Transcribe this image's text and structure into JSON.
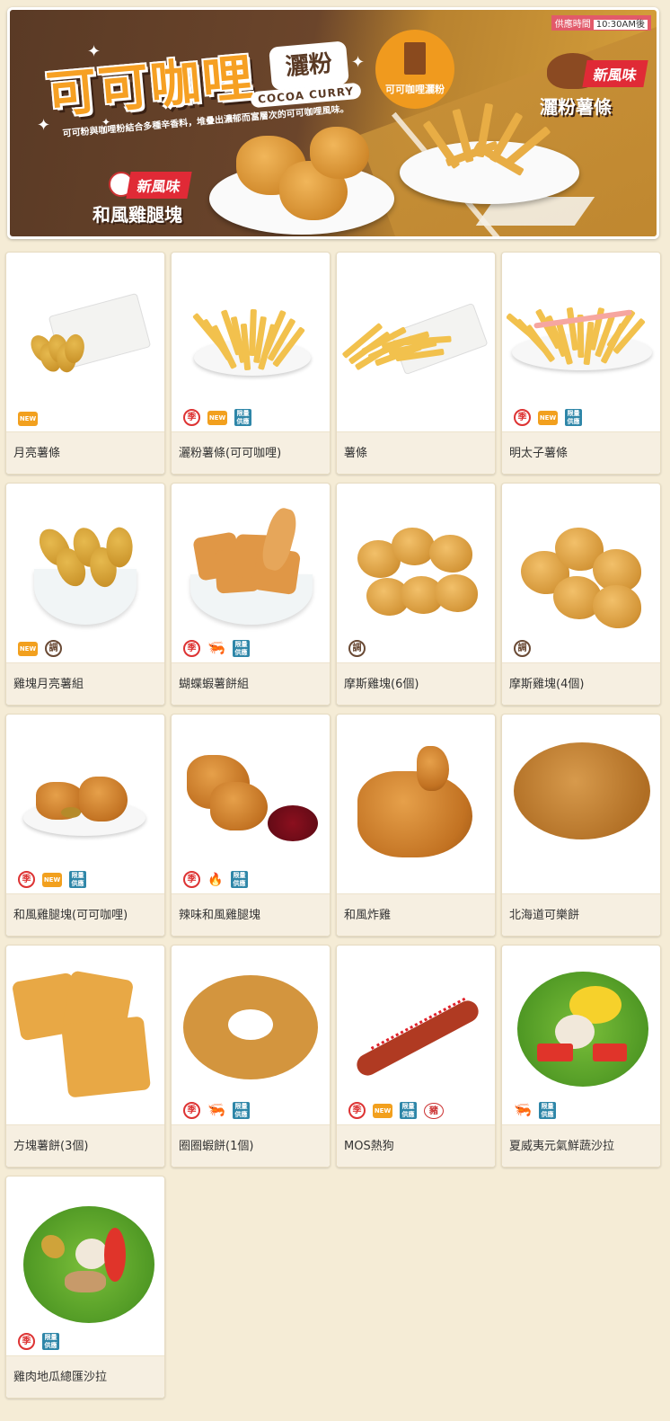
{
  "banner": {
    "title": "可可咖哩",
    "title_sub": "灑粉",
    "subtitle_en": "COCOA CURRY",
    "description": "可可粉與咖哩粉結合多種辛香料，堆疊出濃郁而富層次的可可咖哩風味。",
    "seasoning_badge": "可可咖哩灑粉",
    "hours_label": "供應時間",
    "hours_value": "10:30AM後",
    "new_tag_left": "新風味",
    "new_tag_right": "新風味",
    "product_left": "和風雞腿塊",
    "product_right": "灑粉薯條"
  },
  "icon_labels": {
    "season": "季",
    "new": "NEW",
    "limited": "限量供應",
    "seasoning": "調",
    "spicy": "辣",
    "pork": "豬"
  },
  "products": [
    {
      "name": "月亮薯條",
      "icons": [
        "new-icon"
      ],
      "food": "wedges-bag"
    },
    {
      "name": "灑粉薯條(可可咖哩)",
      "icons": [
        "season-icon",
        "new-icon",
        "limited-icon"
      ],
      "food": "fries-plate"
    },
    {
      "name": "薯條",
      "icons": [],
      "food": "fries-bag"
    },
    {
      "name": "明太子薯條",
      "icons": [
        "season-icon",
        "new-icon",
        "limited-icon"
      ],
      "food": "mentaiko-fries"
    },
    {
      "name": "雞塊月亮薯組",
      "icons": [
        "new-icon",
        "seasoning-icon"
      ],
      "food": "wedge-bowl"
    },
    {
      "name": "蝴蝶蝦薯餅組",
      "icons": [
        "season-icon",
        "shrimp-icon",
        "limited-icon"
      ],
      "food": "shrimp-bowl"
    },
    {
      "name": "摩斯雞塊(6個)",
      "icons": [
        "seasoning-icon"
      ],
      "food": "nuggets6"
    },
    {
      "name": "摩斯雞塊(4個)",
      "icons": [
        "seasoning-icon"
      ],
      "food": "nuggets4"
    },
    {
      "name": "和風雞腿塊(可可咖哩)",
      "icons": [
        "season-icon",
        "new-icon",
        "limited-icon"
      ],
      "food": "chicken-plate"
    },
    {
      "name": "辣味和風雞腿塊",
      "icons": [
        "season-icon",
        "spicy-icon",
        "limited-icon"
      ],
      "food": "chicken-sauce"
    },
    {
      "name": "和風炸雞",
      "icons": [],
      "food": "fried-chicken"
    },
    {
      "name": "北海道可樂餅",
      "icons": [],
      "food": "croquette"
    },
    {
      "name": "方塊薯餅(3個)",
      "icons": [],
      "food": "hashbrown"
    },
    {
      "name": "圈圈蝦餅(1個)",
      "icons": [
        "season-icon",
        "shrimp-icon",
        "limited-icon"
      ],
      "food": "shrimp-ring"
    },
    {
      "name": "MOS熱狗",
      "icons": [
        "season-icon",
        "new-icon",
        "limited-icon",
        "pork-icon"
      ],
      "food": "hotdog"
    },
    {
      "name": "夏威夷元氣鮮蔬沙拉",
      "icons": [
        "shrimp-icon",
        "limited-icon"
      ],
      "food": "salad-corn"
    },
    {
      "name": "雞肉地瓜總匯沙拉",
      "icons": [
        "season-icon",
        "limited-icon"
      ],
      "food": "salad-chicken"
    }
  ]
}
